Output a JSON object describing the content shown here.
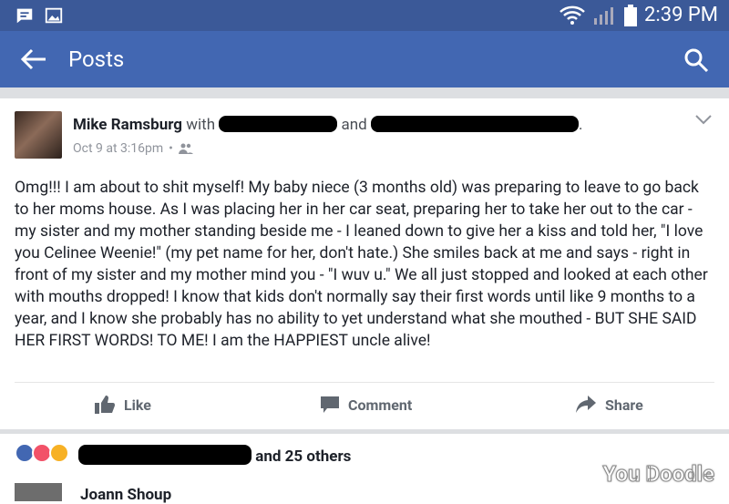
{
  "status_bar": {
    "time": "2:39 PM",
    "icons": [
      "message-icon",
      "image-icon",
      "wifi-icon",
      "signal-icon",
      "battery-icon"
    ]
  },
  "app_bar": {
    "title": "Posts"
  },
  "post": {
    "author": "Mike Ramsburg",
    "with_text": "with",
    "and_text": "and",
    "timestamp": "Oct 9 at 3:16pm",
    "audience_icon": "friends-icon",
    "body": "Omg!!! I am about to shit myself! My baby niece (3 months old) was preparing to leave to go back to her moms house. As I was placing her in her car seat, preparing her to take her out to the car -  my sister and my mother standing beside me - I leaned down to give her a kiss and told her, \"I love you Celinee Weenie!\" (my pet name for her, don't hate.) She smiles back at me and says - right in front of my sister and my mother mind you - \"I wuv u.\" We all just stopped and looked at each other with mouths dropped! I know that kids don't normally say their first words until like 9 months to a year, and I know she probably has no ability to yet understand what she mouthed - BUT SHE SAID HER FIRST WORDS! TO ME! I am the HAPPIEST uncle alive!",
    "actions": {
      "like": "Like",
      "comment": "Comment",
      "share": "Share"
    }
  },
  "reactions": {
    "summary": "and 25 others",
    "types": [
      "like",
      "love",
      "wow"
    ]
  },
  "comments": [
    {
      "author": "Joann Shoup"
    }
  ],
  "watermark": "You Doodle",
  "colors": {
    "status_bar": "#3b5998",
    "app_bar": "#4267b2",
    "link": "#4267b2"
  }
}
